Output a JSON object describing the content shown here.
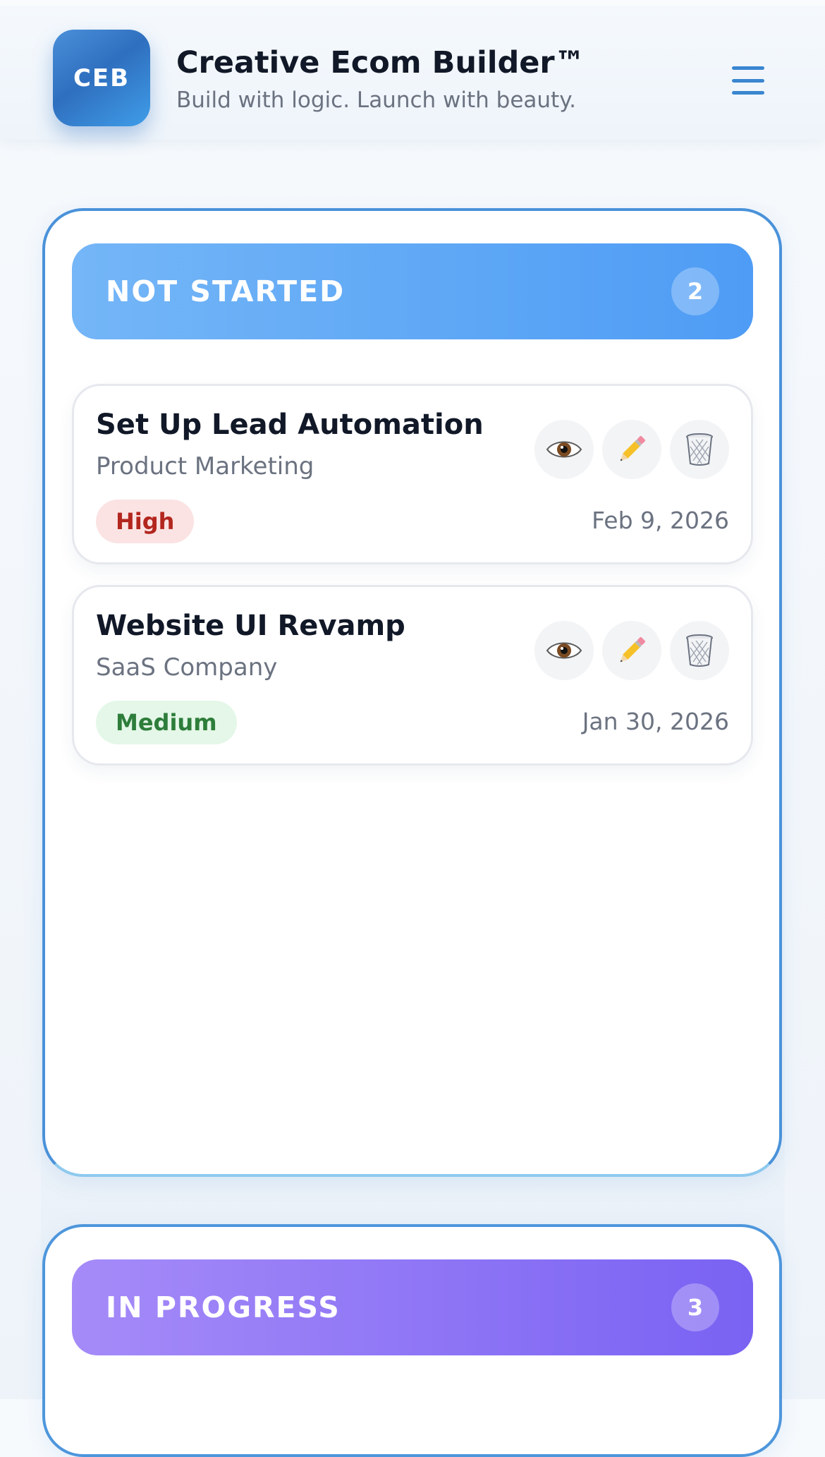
{
  "header": {
    "logo_text": "CEB",
    "title": "Creative Ecom Builder™",
    "tagline": "Build with logic. Launch with beauty."
  },
  "columns": [
    {
      "title": "NOT STARTED",
      "count": "2",
      "accent": "#4e9cf5",
      "tasks": [
        {
          "title": "Set Up Lead Automation",
          "subtitle": "Product Marketing",
          "priority": "High",
          "date": "Feb 9, 2026",
          "actions": [
            "eye-icon",
            "pencil-icon",
            "trash-icon"
          ]
        },
        {
          "title": "Website UI Revamp",
          "subtitle": "SaaS Company",
          "priority": "Medium",
          "date": "Jan 30, 2026",
          "actions": [
            "eye-icon",
            "pencil-icon",
            "trash-icon"
          ]
        }
      ]
    },
    {
      "title": "IN PROGRESS",
      "count": "3",
      "accent": "#7a62f3",
      "tasks": []
    }
  ],
  "colors": {
    "brand": "#2f6fbf",
    "menu": "#3a86d0",
    "priority_high_text": "#b3261e",
    "priority_high_bg": "#fbe3e3",
    "priority_medium_text": "#2e7d3b",
    "priority_medium_bg": "#e4f7e8"
  }
}
